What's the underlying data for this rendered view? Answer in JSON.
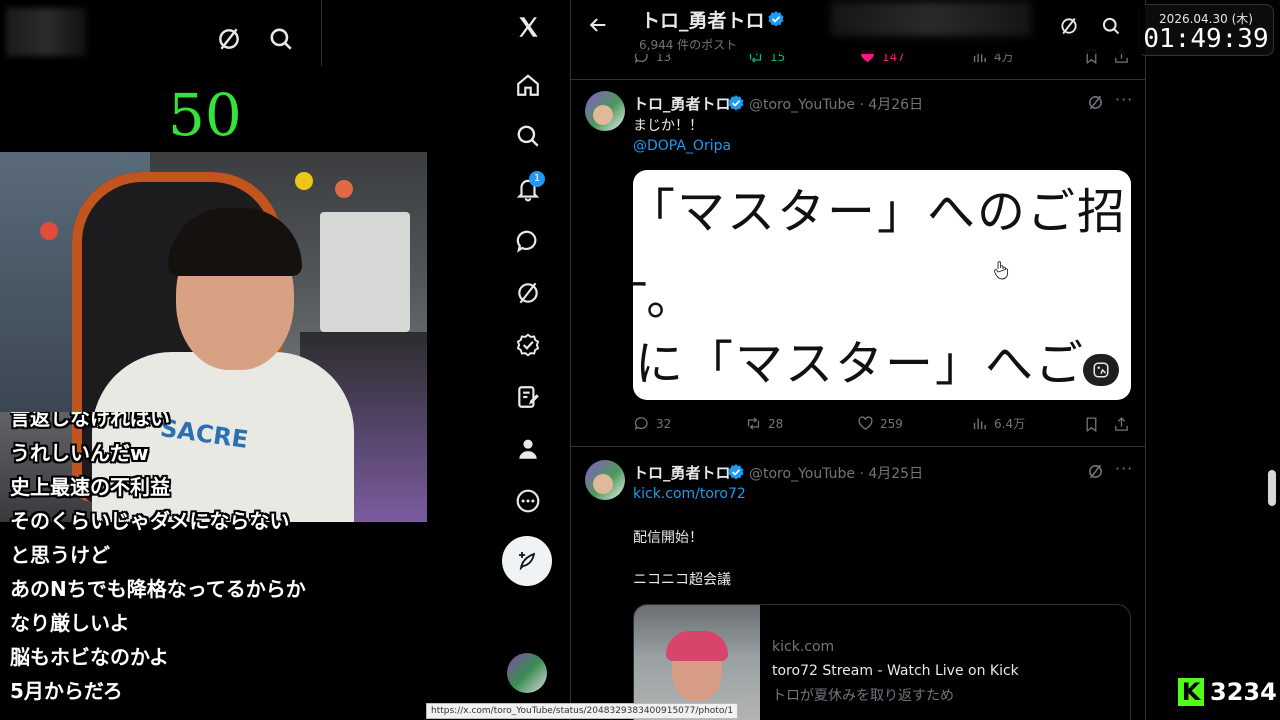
{
  "stream": {
    "counter": "50",
    "shirt_text": "SACRE",
    "comments": [
      "言返しなければい",
      "うれしいんだw",
      "史上最速の不利益",
      "そのくらいじゃダメにならない",
      "と思うけど",
      "あのNちでも降格なってるからか",
      "なり厳しいよ",
      "脳もホビなのかよ",
      "5月からだろ"
    ]
  },
  "nav": {
    "notification_count": "1",
    "icons": [
      "x-logo-icon",
      "home-icon",
      "search-icon",
      "notifications-icon",
      "messages-icon",
      "grok-icon",
      "verified-orgs-icon",
      "premium-icon",
      "profile-icon",
      "more-icon"
    ]
  },
  "header": {
    "name": "トロ_勇者トロ",
    "post_count": "6,944 件のポスト"
  },
  "prev_tweet": {
    "replies": "13",
    "reposts": "15",
    "likes": "147",
    "views": "4万"
  },
  "tweets": [
    {
      "name": "トロ_勇者トロ",
      "handle_date": "@toro_YouTube · 4月26日",
      "text": "まじか！！",
      "mention": "@DOPA_Oripa",
      "media_lines": [
        "「マスター」へのご招",
        "す。",
        "なに「マスター」へご"
      ],
      "replies": "32",
      "reposts": "28",
      "likes": "259",
      "views": "6.4万"
    },
    {
      "name": "トロ_勇者トロ",
      "handle_date": "@toro_YouTube · 4月25日",
      "link": "kick.com/toro72",
      "line1": "配信開始！",
      "line2": "ニコニコ超会議",
      "card": {
        "domain": "kick.com",
        "title": "toro72 Stream - Watch Live on Kick",
        "description": "トロが夏休みを取り返すため"
      }
    }
  ],
  "overlay": {
    "date": "2026.04.30 (木)",
    "time": "01:49:39",
    "kick_count": "3234",
    "kick_letter": "K"
  },
  "status_url": "https://x.com/toro_YouTube/status/2048329383400915077/photo/1",
  "colors": {
    "accent": "#1d9bf0",
    "counter": "#35e23a",
    "kick": "#53fc18",
    "like": "#f91880",
    "repost": "#00ba7c"
  }
}
